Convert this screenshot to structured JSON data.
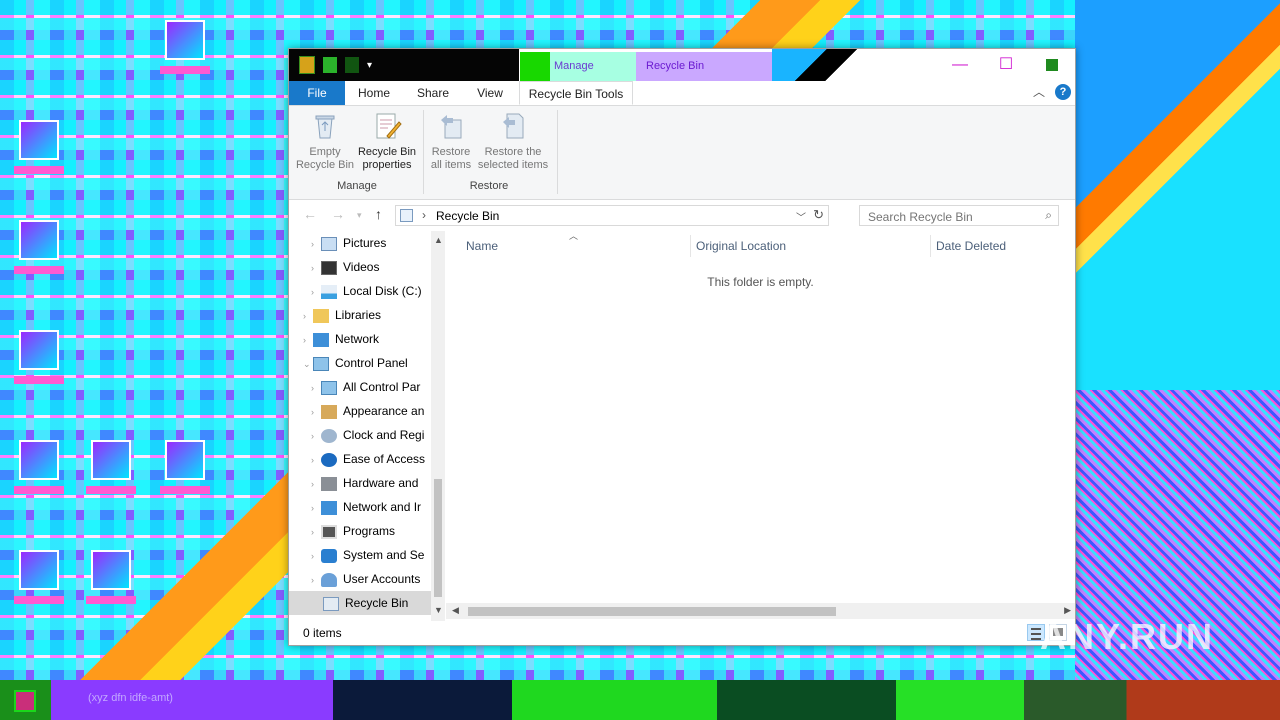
{
  "window": {
    "context_tab": "Manage",
    "title": "Recycle Bin",
    "controls": {
      "minimize": "—",
      "maximize": "☐",
      "close": ""
    }
  },
  "ribbon_tabs": [
    "File",
    "Home",
    "Share",
    "View",
    "Recycle Bin Tools"
  ],
  "ribbon": {
    "manage_group": {
      "label": "Manage",
      "buttons": [
        {
          "line1": "Empty",
          "line2": "Recycle Bin"
        },
        {
          "line1": "Recycle Bin",
          "line2": "properties"
        }
      ]
    },
    "restore_group": {
      "label": "Restore",
      "buttons": [
        {
          "line1": "Restore",
          "line2": "all items"
        },
        {
          "line1": "Restore the",
          "line2": "selected items"
        }
      ]
    }
  },
  "address": {
    "path": "Recycle Bin",
    "search_placeholder": "Search Recycle Bin"
  },
  "nav_pane": {
    "items": [
      {
        "label": "Pictures",
        "icon": "pictures-icon"
      },
      {
        "label": "Videos",
        "icon": "videos-icon"
      },
      {
        "label": "Local Disk (C:)",
        "icon": "drive-icon"
      },
      {
        "label": "Libraries",
        "icon": "libraries-icon"
      },
      {
        "label": "Network",
        "icon": "network-icon"
      },
      {
        "label": "Control Panel",
        "icon": "control-panel-icon"
      },
      {
        "label": "All Control Par",
        "icon": "control-panel-icon"
      },
      {
        "label": "Appearance an",
        "icon": "appearance-icon"
      },
      {
        "label": "Clock and Regi",
        "icon": "clock-icon"
      },
      {
        "label": "Ease of Access",
        "icon": "ease-of-access-icon"
      },
      {
        "label": "Hardware and",
        "icon": "hardware-icon"
      },
      {
        "label": "Network and Ir",
        "icon": "network-internet-icon"
      },
      {
        "label": "Programs",
        "icon": "programs-icon"
      },
      {
        "label": "System and Se",
        "icon": "system-security-icon"
      },
      {
        "label": "User Accounts",
        "icon": "user-accounts-icon"
      },
      {
        "label": "Recycle Bin",
        "icon": "recycle-bin-icon"
      }
    ]
  },
  "columns": [
    "Name",
    "Original Location",
    "Date Deleted"
  ],
  "empty_message": "This folder is empty.",
  "status": {
    "item_count": "0 items"
  },
  "taskbar": {
    "title": "(xyz dfn idfe-amt)"
  },
  "watermark": "ANY.RUN",
  "colors": {
    "file_tab": "#1979ca",
    "selection": "#d9d9d9",
    "window_bg": "#ffffff"
  }
}
